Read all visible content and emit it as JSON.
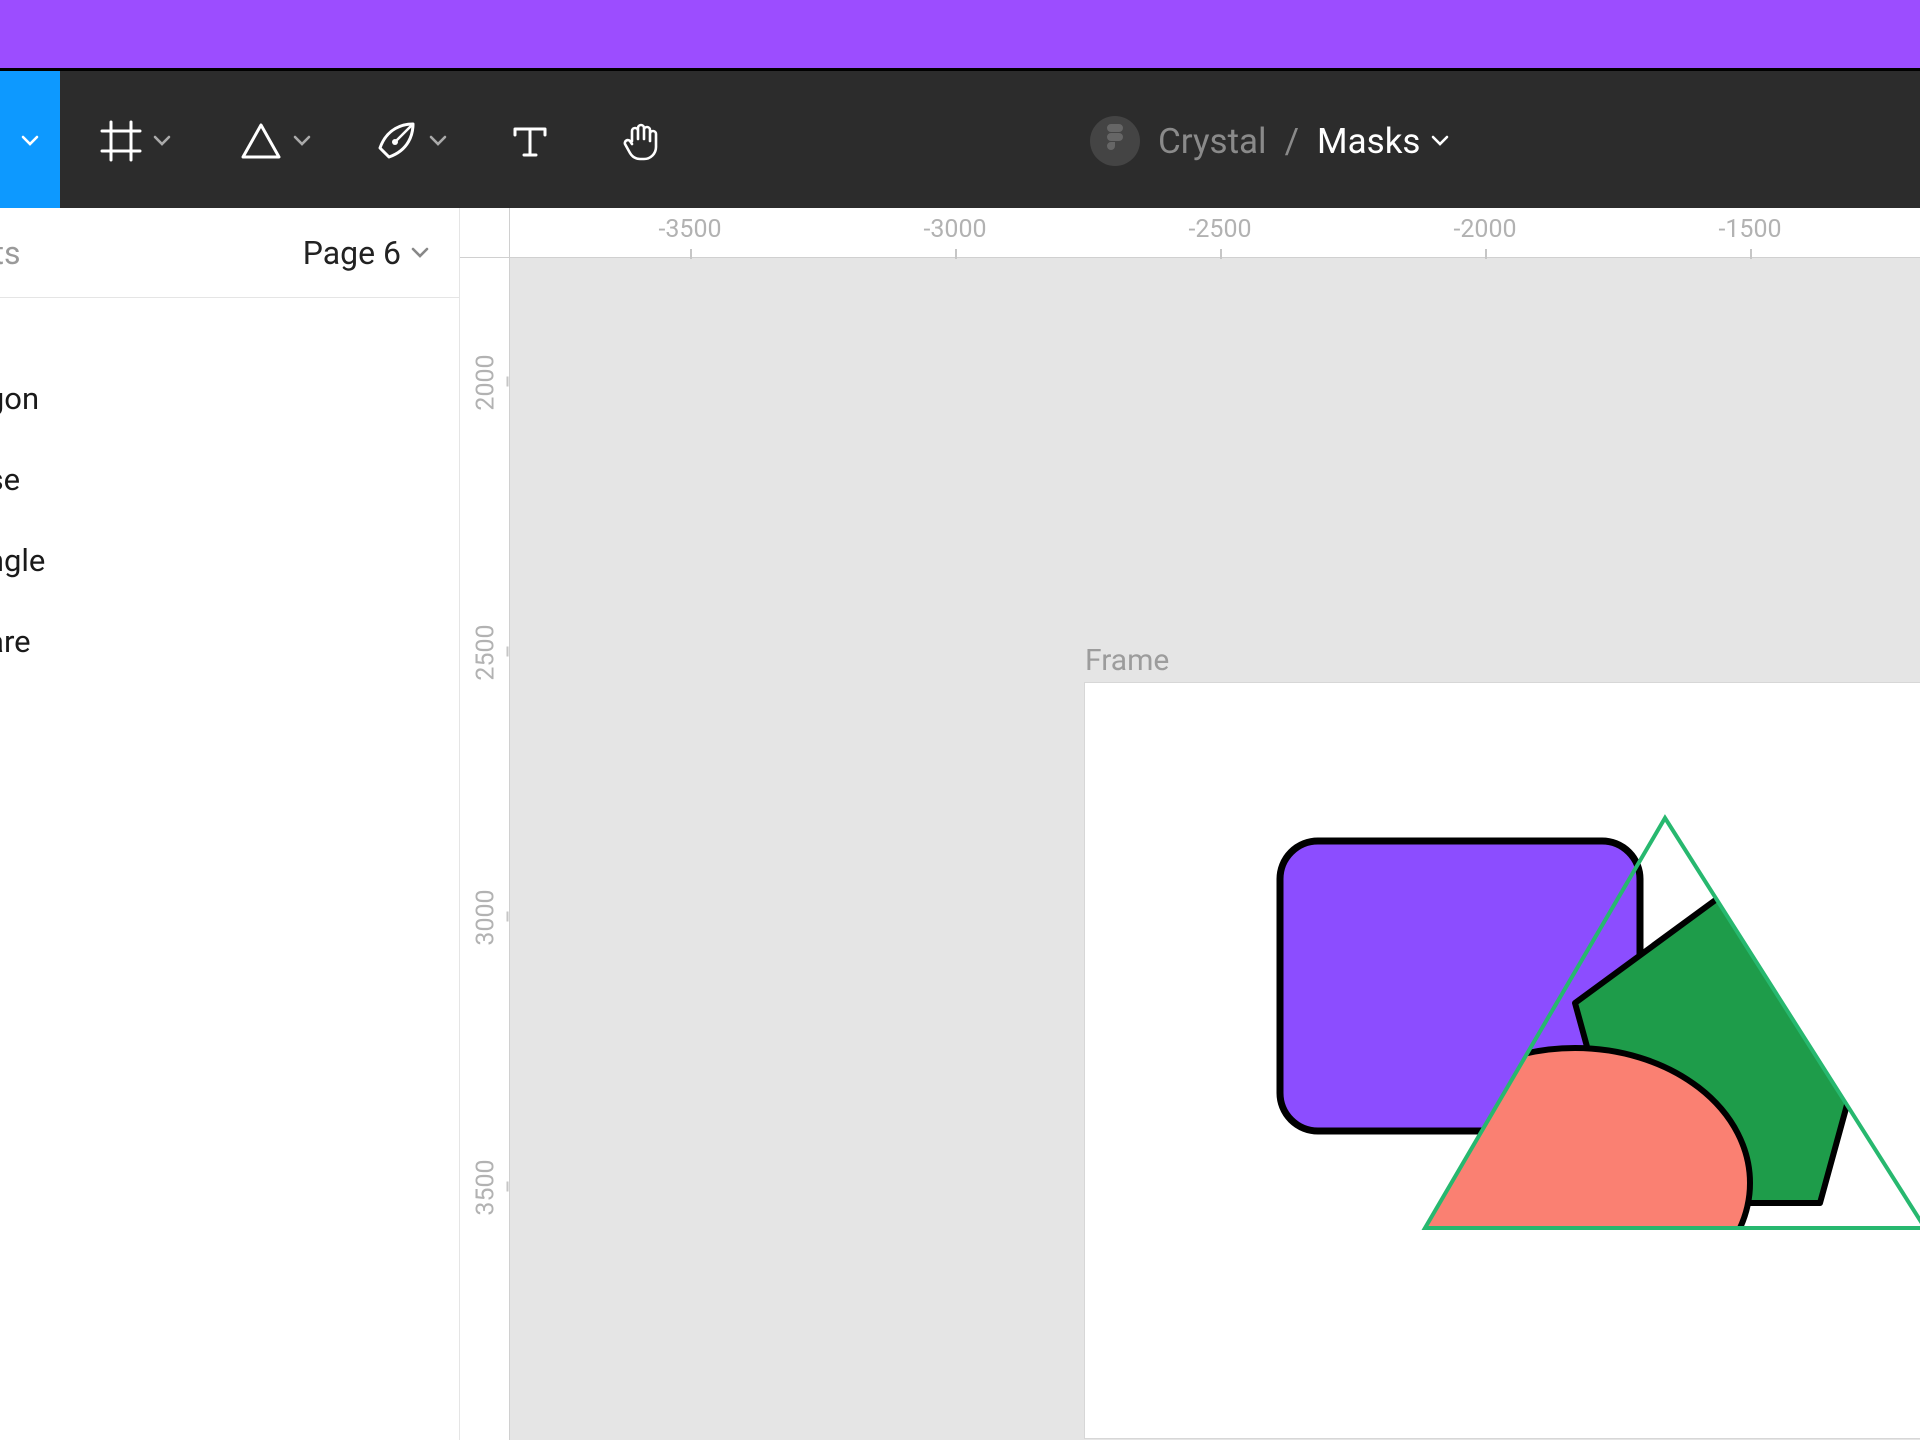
{
  "toolbar": {
    "tools": {
      "move": "move-tool",
      "frame": "frame-tool",
      "shape": "shape-tool",
      "pen": "pen-tool",
      "text": "text-tool",
      "hand": "hand-tool"
    }
  },
  "breadcrumb": {
    "project": "Crystal",
    "file": "Masks"
  },
  "sidebar": {
    "tab": "sets",
    "page": "Page 6",
    "layers": [
      "agon",
      "ose",
      "angle",
      "uare"
    ]
  },
  "ruler": {
    "h": [
      "-3500",
      "-3000",
      "-2500",
      "-2000",
      "-1500"
    ],
    "v": [
      "2000",
      "2500",
      "3000",
      "3500"
    ]
  },
  "canvas": {
    "frame_label": "Frame"
  },
  "colors": {
    "accent": "#0D99FF",
    "banner": "#9C4DFF",
    "rect": "#8C4DFF",
    "pentagon": "#1E9C4A",
    "ellipse": "#FA8072",
    "triangle_outline": "#27B86F"
  }
}
